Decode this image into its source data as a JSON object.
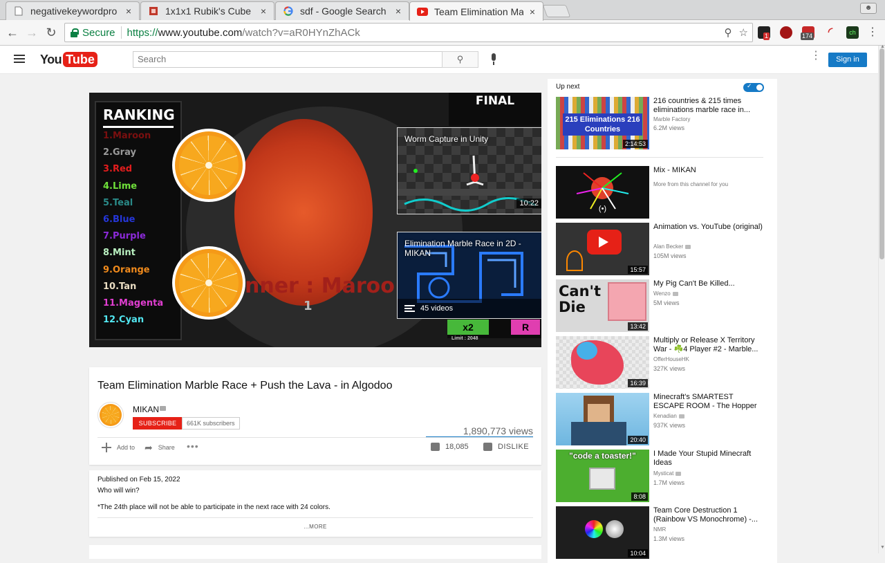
{
  "browser": {
    "tabs": [
      {
        "label": "negativekeywordpro",
        "icon": "document-icon"
      },
      {
        "label": "1x1x1 Rubik's Cube",
        "icon": "rubiks-icon"
      },
      {
        "label": "sdf - Google Search",
        "icon": "google-icon"
      },
      {
        "label": "Team Elimination Ma",
        "icon": "youtube-icon",
        "active": true
      }
    ],
    "close_glyph": "×",
    "secure_label": "Secure",
    "url": {
      "scheme": "https://",
      "host": "www.youtube.com",
      "path": "/watch?v=aR0HYnZhACk"
    },
    "extensions": [
      {
        "name": "ext-a-icon",
        "badge": "1"
      },
      {
        "name": "ext-b-icon",
        "badge": ""
      },
      {
        "name": "ext-c-icon",
        "badge": "174"
      },
      {
        "name": "ext-d-icon",
        "badge": ""
      },
      {
        "name": "ext-e-icon",
        "label": "ch",
        "badge": ""
      }
    ],
    "colors": {
      "secure": "#0b8043"
    }
  },
  "youtube": {
    "logo_you": "You",
    "logo_tube": "Tube",
    "search_placeholder": "Search",
    "signin_label": "Sign in",
    "brand_red": "#e62117",
    "accent_blue": "#167ac6"
  },
  "player": {
    "ranking_title": "RANKING",
    "ranking": [
      {
        "label": "1.Maroon",
        "color": "#7a0f0f"
      },
      {
        "label": "2.Gray",
        "color": "#9a9a9a"
      },
      {
        "label": "3.Red",
        "color": "#e21d1d"
      },
      {
        "label": "4.Lime",
        "color": "#6fe03a"
      },
      {
        "label": "5.Teal",
        "color": "#2a8a88"
      },
      {
        "label": "6.Blue",
        "color": "#2536d8"
      },
      {
        "label": "7.Purple",
        "color": "#8b2ad8"
      },
      {
        "label": "8.Mint",
        "color": "#b9f0c0"
      },
      {
        "label": "9.Orange",
        "color": "#f08a1c"
      },
      {
        "label": "10.Tan",
        "color": "#e9dcc2"
      },
      {
        "label": "11.Magenta",
        "color": "#e03ed0"
      },
      {
        "label": "12.Cyan",
        "color": "#52e6f0"
      }
    ],
    "final_label": "FINAL",
    "winner_text": "nner : Maroo",
    "winner_number": "1",
    "multiplier": "x2",
    "r_label": "R",
    "limit_text": "Limit : 2048",
    "endcards": [
      {
        "title": "Worm Capture in Unity",
        "duration": "10:22"
      },
      {
        "title": "Elimination Marble Race in 2D - MIKAN",
        "playlist_count": "45 videos"
      }
    ]
  },
  "video": {
    "title": "Team Elimination Marble Race + Push the Lava - in Algodoo",
    "channel": "MIKAN",
    "subscribe_label": "SUBSCRIBE",
    "subscribers": "661K subscribers",
    "views": "1,890,773 views",
    "add_to_label": "Add to",
    "share_label": "Share",
    "more_glyph": "•••",
    "likes": "18,085",
    "dislike_label": "DISLIKE"
  },
  "description": {
    "published": "Published on Feb 15, 2022",
    "line1": "Who will win?",
    "line2": "*The 24th place will not be able to participate in the next race with 24 colors.",
    "more_label": "...MORE"
  },
  "sidebar": {
    "upnext_label": "Up next",
    "autoplay_on": true,
    "items": [
      {
        "title": "216 countries & 215 times eliminations marble race in...",
        "channel": "Marble Factory",
        "views": "6.2M views",
        "duration": "2:14:53",
        "thumb_text": "215 Eliminations 216 Countries"
      },
      {
        "title": "Mix - MIKAN",
        "channel": "More from this channel for you",
        "views": "",
        "duration": ""
      },
      {
        "title": "Animation vs. YouTube (original)",
        "channel": "Alan Becker",
        "views": "105M views",
        "duration": "15:57",
        "verified": true
      },
      {
        "title": "My Pig Can't Be Killed...",
        "channel": "Wenzo",
        "views": "5M views",
        "duration": "13:42",
        "verified": true,
        "thumb_text": "Can't Die"
      },
      {
        "title": "Multiply or Release X Territory War - ☘️4 Player #2 - Marble...",
        "channel": "OfferHouseHK",
        "views": "327K views",
        "duration": "16:39"
      },
      {
        "title": "Minecraft's SMARTEST ESCAPE ROOM - The Hopper",
        "channel": "Kenadian",
        "views": "937K views",
        "duration": "20:40",
        "verified": true
      },
      {
        "title": "I Made Your Stupid Minecraft Ideas",
        "channel": "Mysticat",
        "views": "1.7M views",
        "duration": "8:08",
        "verified": true,
        "thumb_text": "\"code a toaster!\""
      },
      {
        "title": "Team Core Destruction 1 (Rainbow VS Monochrome) -...",
        "channel": "NMR",
        "views": "1.3M views",
        "duration": "10:04"
      }
    ]
  }
}
